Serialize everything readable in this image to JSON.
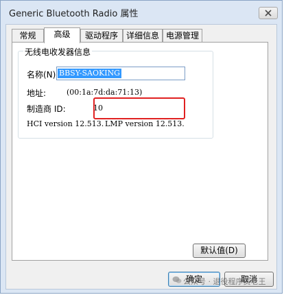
{
  "window": {
    "title": "Generic Bluetooth Radio 属性",
    "close_label": "×"
  },
  "tabs": [
    {
      "label": "常规",
      "active": false
    },
    {
      "label": "高级",
      "active": true
    },
    {
      "label": "驱动程序",
      "active": false
    },
    {
      "label": "详细信息",
      "active": false
    },
    {
      "label": "电源管理",
      "active": false
    }
  ],
  "group": {
    "title": "无线电收发器信息",
    "name_label": "名称(N):",
    "name_value": "BBSY-SAOKING",
    "address_label": "地址:",
    "address_value": "(00:1a:7d:da:71:13)",
    "manufacturer_label": "制造商 ID:",
    "manufacturer_value": "10",
    "hci_version": "HCI version 12.513.",
    "lmp_version": "LMP version 12.513."
  },
  "buttons": {
    "default_value": "默认值(D)",
    "ok": "确定",
    "cancel": "取消"
  },
  "watermark": "公众号 · 退役程序员老王",
  "colors": {
    "accent": "#3399ff",
    "highlight": "#e02020",
    "frame": "#dbe6f4"
  }
}
